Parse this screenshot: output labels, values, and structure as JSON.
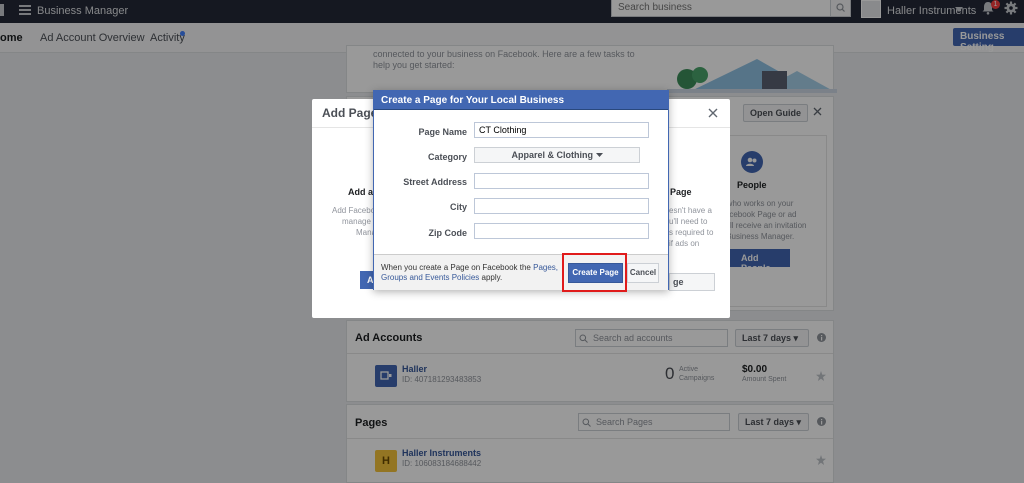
{
  "topbar": {
    "app_title": "Business Manager",
    "search_placeholder": "Search business",
    "business_name": "Haller Instruments",
    "notification_count": "1"
  },
  "nav": {
    "tabs": [
      {
        "label": "ome"
      },
      {
        "label": "Ad Account Overview"
      },
      {
        "label": "Activity"
      }
    ],
    "settings_button": "Business Setting"
  },
  "background": {
    "intro_line1": "connected to your business on Facebook. Here are a few tasks to",
    "intro_line2": "help you get started:",
    "open_guide_button": "Open Guide",
    "people_title": "People",
    "people_text1": "e who works on your",
    "people_text2": "Facebook Page or ad",
    "people_text3": "ey'll receive an invitation",
    "people_text4": "s Business Manager.",
    "add_people_button": "Add People",
    "ad_accounts": {
      "title": "Ad Accounts",
      "search_placeholder": "Search ad accounts",
      "range": "Last 7 days",
      "rows": [
        {
          "name": "Haller",
          "id": "ID: 407181293483853",
          "active_count": "0",
          "active_label1": "Active",
          "active_label2": "Campaigns",
          "amount": "$0.00",
          "amount_label": "Amount Spent"
        }
      ]
    },
    "pages": {
      "title": "Pages",
      "search_placeholder": "Search Pages",
      "range": "Last 7 days",
      "rows": [
        {
          "name": "Haller Instruments",
          "id": "ID: 106083184688442",
          "initial": "H"
        }
      ]
    }
  },
  "outer_modal": {
    "title": "Add Pages",
    "left_col_title": "Add a",
    "left_col_l1": "Add Facebo",
    "left_col_l2": "manage",
    "left_col_l3": "Mana",
    "mid_title": "Page",
    "mid_l1": "esn't have a",
    "mid_l2": "u'll need to",
    "mid_l3": "s required to",
    "mid_l4": "if ads on",
    "mid_btn_fragment": "ge",
    "left_btn_fragment": "A"
  },
  "dialog": {
    "title": "Create a Page for Your Local Business",
    "fields": {
      "page_name_label": "Page Name",
      "page_name_value": "CT Clothing",
      "category_label": "Category",
      "category_value": "Apparel & Clothing",
      "street_label": "Street Address",
      "street_value": "",
      "city_label": "City",
      "city_value": "",
      "zip_label": "Zip Code",
      "zip_value": ""
    },
    "footer_pre": "When you create a Page on Facebook the ",
    "footer_link": "Pages, Groups and Events Policies",
    "footer_post": " apply.",
    "create_button": "Create Page",
    "cancel_button": "Cancel"
  },
  "colors": {
    "brand_blue": "#4267b2",
    "highlight_red": "#e01b1b",
    "topbar": "#232937"
  }
}
